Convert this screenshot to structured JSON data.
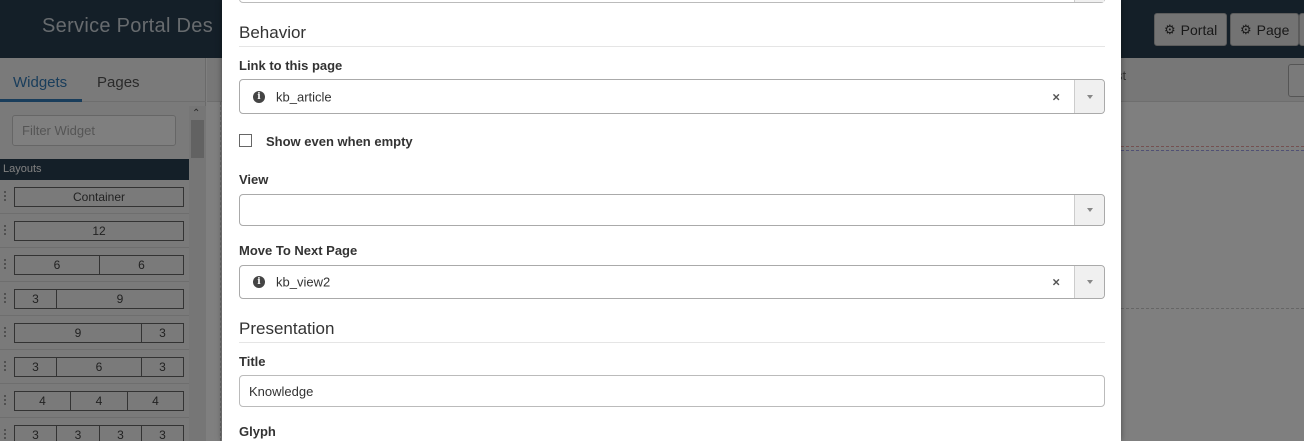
{
  "header": {
    "app_title": "Service Portal Des",
    "buttons": [
      "Portal",
      "Page"
    ]
  },
  "sidebar": {
    "tabs": [
      "Widgets",
      "Pages"
    ],
    "filter_placeholder": "Filter Widget",
    "layouts_title": "Layouts",
    "layouts": [
      [
        "Container"
      ],
      [
        "12"
      ],
      [
        "6",
        "6"
      ],
      [
        "3",
        "9"
      ],
      [
        "9",
        "3"
      ],
      [
        "3",
        "6",
        "3"
      ],
      [
        "4",
        "4",
        "4"
      ],
      [
        "3",
        "3",
        "3",
        "3"
      ]
    ]
  },
  "canvas": {
    "ghost_text": "st"
  },
  "modal": {
    "behavior_title": "Behavior",
    "link_label": "Link to this page",
    "link_value": "kb_article",
    "show_empty_label": "Show even when empty",
    "view_label": "View",
    "view_value": "",
    "next_page_label": "Move To Next Page",
    "next_page_value": "kb_view2",
    "presentation_title": "Presentation",
    "title_label": "Title",
    "title_value": "Knowledge",
    "glyph_label": "Glyph"
  }
}
